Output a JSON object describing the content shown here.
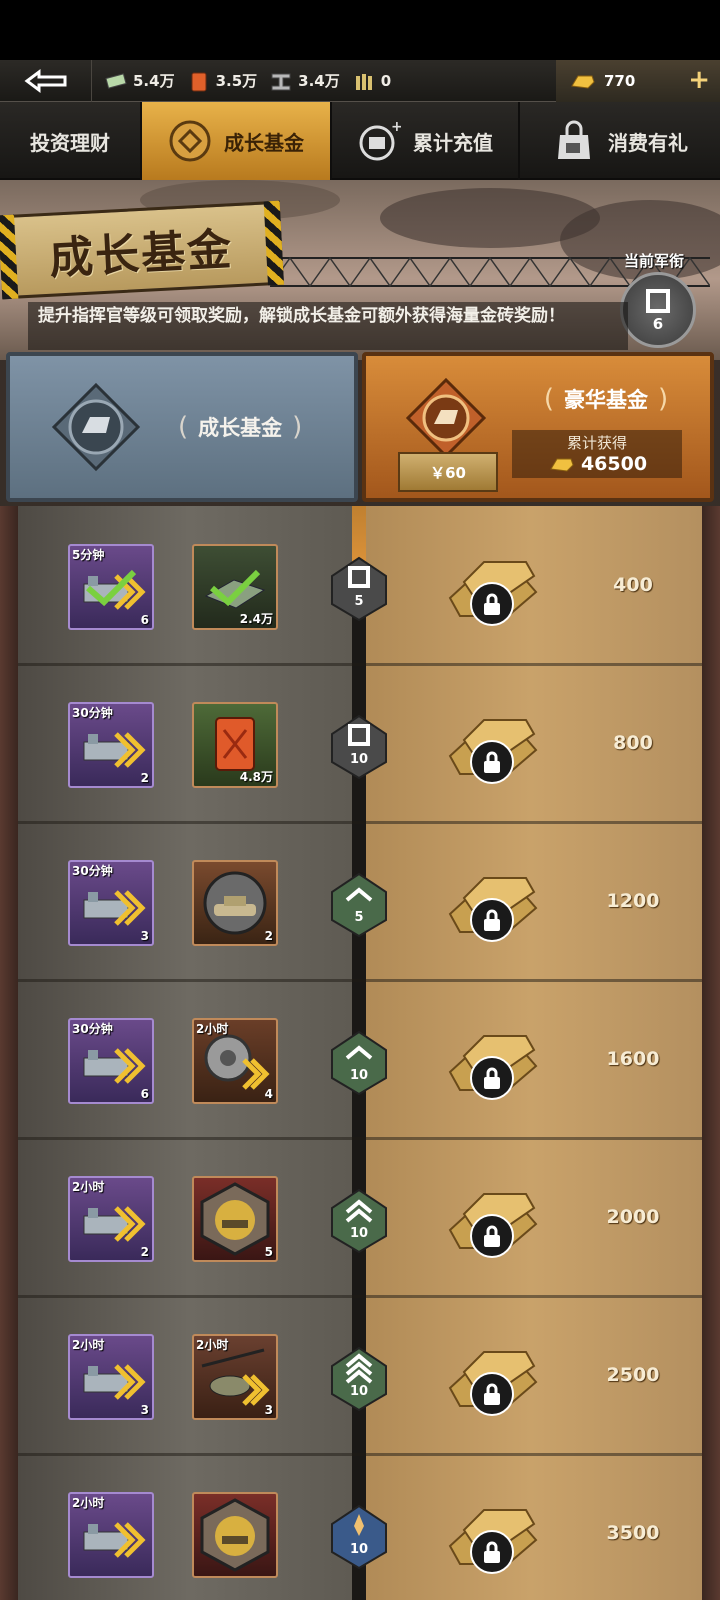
{
  "resources": {
    "cash": "5.4万",
    "oil": "3.5万",
    "steel": "3.4万",
    "ammo": "0",
    "gold": "770",
    "add_label": "+"
  },
  "tabs": [
    {
      "label": "投资理财",
      "icon": "investment-icon",
      "active": false
    },
    {
      "label": "成长基金",
      "icon": "growth-fund-icon",
      "active": true
    },
    {
      "label": "累计充值",
      "icon": "recharge-icon",
      "active": false
    },
    {
      "label": "消费有礼",
      "icon": "gift-bag-icon",
      "active": false
    }
  ],
  "banner": {
    "title": "成长基金",
    "rank_label": "当前军衔",
    "rank_value": "6",
    "notice": "提升指挥官等级可领取奖励，解锁成长基金可额外获得海量金砖奖励！"
  },
  "funds": {
    "basic": {
      "title": "成长基金"
    },
    "deluxe": {
      "title": "豪华基金",
      "price": "￥60",
      "accum_label": "累计获得",
      "accum_value": "46500"
    }
  },
  "rows": [
    {
      "item1": {
        "time": "5分钟",
        "count": "6",
        "kind": "speedup",
        "claimed": true
      },
      "item2": {
        "time": "",
        "count": "2.4万",
        "kind": "cash",
        "claimed": true
      },
      "level": "5",
      "rank_kind": "square",
      "gold": "400"
    },
    {
      "item1": {
        "time": "30分钟",
        "count": "2",
        "kind": "speedup"
      },
      "item2": {
        "time": "",
        "count": "4.8万",
        "kind": "oil"
      },
      "level": "10",
      "rank_kind": "square",
      "gold": "800"
    },
    {
      "item1": {
        "time": "30分钟",
        "count": "3",
        "kind": "speedup"
      },
      "item2": {
        "time": "",
        "count": "2",
        "kind": "tank"
      },
      "level": "5",
      "rank_kind": "chevron1",
      "gold": "1200"
    },
    {
      "item1": {
        "time": "30分钟",
        "count": "6",
        "kind": "speedup"
      },
      "item2": {
        "time": "2小时",
        "count": "4",
        "kind": "gear"
      },
      "level": "10",
      "rank_kind": "chevron1",
      "gold": "1600"
    },
    {
      "item1": {
        "time": "2小时",
        "count": "2",
        "kind": "speedup"
      },
      "item2": {
        "time": "",
        "count": "5",
        "kind": "tank-medal"
      },
      "level": "10",
      "rank_kind": "chevron2",
      "gold": "2000"
    },
    {
      "item1": {
        "time": "2小时",
        "count": "3",
        "kind": "speedup"
      },
      "item2": {
        "time": "2小时",
        "count": "3",
        "kind": "helicopter"
      },
      "level": "10",
      "rank_kind": "chevron3",
      "gold": "2500"
    },
    {
      "item1": {
        "time": "2小时",
        "count": "",
        "kind": "speedup"
      },
      "item2": {
        "time": "",
        "count": "",
        "kind": "tank-medal"
      },
      "level": "10",
      "rank_kind": "star",
      "gold": "3500"
    }
  ],
  "colors": {
    "accent": "#e8b24a",
    "deluxe": "#c9762a",
    "basic": "#6f8496"
  }
}
